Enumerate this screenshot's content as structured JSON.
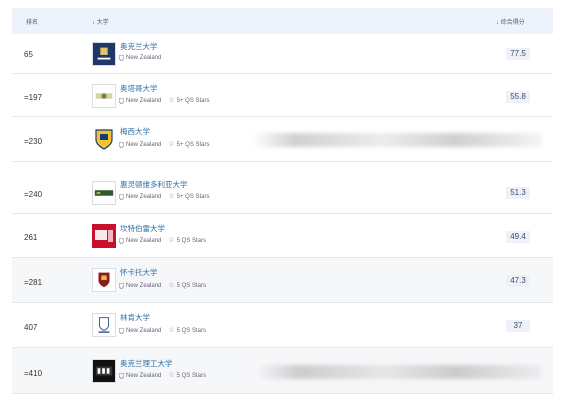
{
  "table": {
    "header": {
      "rank": "排名",
      "university": "↓ 大学",
      "score": "↓ 综合得分"
    },
    "rows": [
      {
        "rank": "65",
        "name": "奥克兰大学",
        "location": "New Zealand",
        "stars": "",
        "score": "77.5"
      },
      {
        "rank": "=197",
        "name": "奥塔哥大学",
        "location": "New Zealand",
        "stars": "5+ QS Stars",
        "score": "55.8"
      },
      {
        "rank": "=230",
        "name": "梅西大学",
        "location": "New Zealand",
        "stars": "5+ QS Stars",
        "score": ""
      },
      {
        "rank": "=240",
        "name": "惠灵顿维多利亚大学",
        "location": "New Zealand",
        "stars": "5+ QS Stars",
        "score": "51.3"
      },
      {
        "rank": "261",
        "name": "坎特伯雷大学",
        "location": "New Zealand",
        "stars": "5 QS Stars",
        "score": "49.4"
      },
      {
        "rank": "=281",
        "name": "怀卡托大学",
        "location": "New Zealand",
        "stars": "5 QS Stars",
        "score": "47.3"
      },
      {
        "rank": "407",
        "name": "林肯大学",
        "location": "New Zealand",
        "stars": "5 QS Stars",
        "score": "37"
      },
      {
        "rank": "=410",
        "name": "奥克兰理工大学",
        "location": "New Zealand",
        "stars": "5 QS Stars",
        "score": ""
      }
    ]
  },
  "colors": {
    "header_bg": "#eef3fb",
    "link": "#2c6fa5",
    "score_bg": "#eef2f8",
    "alt_row_bg": "#f6f7f9"
  },
  "icons": [
    "location-pin-icon",
    "star-outline-icon",
    "sort-arrow-icon"
  ]
}
